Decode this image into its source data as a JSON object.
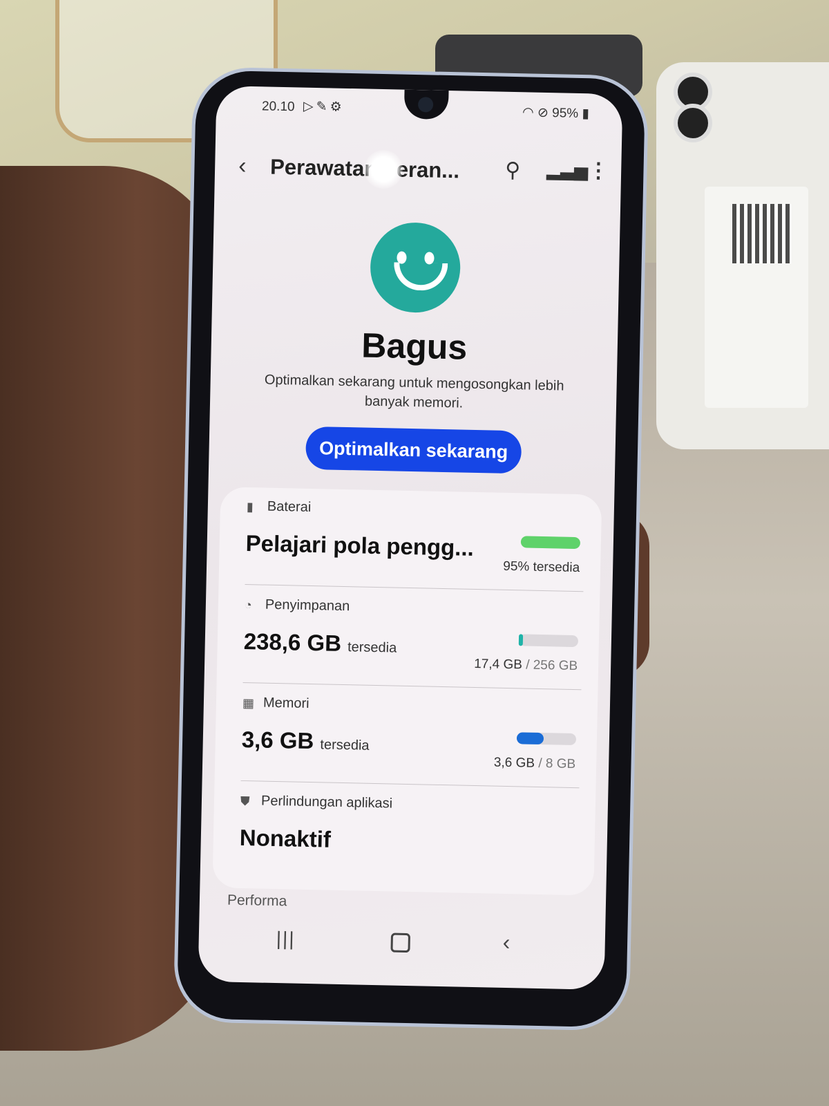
{
  "status_bar": {
    "time": "20.10",
    "left_icons": [
      "play-store-icon",
      "tools-icon",
      "settings-gear-icon"
    ],
    "right_icons": [
      "wifi-icon",
      "do-not-disturb-icon"
    ],
    "battery_percent": "95%"
  },
  "header": {
    "title": "Perawatan peran...",
    "back_icon": "chevron-left-icon",
    "search_icon": "search-icon",
    "chart_icon": "signal-chart-icon",
    "more_icon": "more-vertical-icon"
  },
  "status": {
    "face_icon": "smiley-face-icon",
    "title": "Bagus",
    "description": "Optimalkan sekarang untuk mengosongkan lebih banyak memori.",
    "button_label": "Optimalkan sekarang"
  },
  "items": [
    {
      "icon": "battery-icon",
      "label": "Baterai",
      "value": "Pelajari pola pengg...",
      "unit": "",
      "meta_used": "",
      "meta_total": "95% tersedia",
      "fill_percent": 100,
      "bar_color": "#5fd26a"
    },
    {
      "icon": "storage-pie-icon",
      "label": "Penyimpanan",
      "value": "238,6 GB",
      "unit": "tersedia",
      "meta_used": "17,4 GB",
      "meta_total": " / 256 GB",
      "fill_percent": 7,
      "bar_color": "#1fb3a8"
    },
    {
      "icon": "memory-chip-icon",
      "label": "Memori",
      "value": "3,6 GB",
      "unit": "tersedia",
      "meta_used": "3,6 GB",
      "meta_total": " / 8 GB",
      "fill_percent": 45,
      "bar_color": "#1a6cd6"
    },
    {
      "icon": "shield-icon",
      "label": "Perlindungan aplikasi",
      "value": "Nonaktif"
    }
  ],
  "section_header": "Performa",
  "nav": {
    "recent_icon": "recent-apps-icon",
    "home_icon": "home-icon",
    "back_icon": "back-icon"
  },
  "colors": {
    "accent_button": "#1646e6",
    "face": "#24a99c"
  }
}
